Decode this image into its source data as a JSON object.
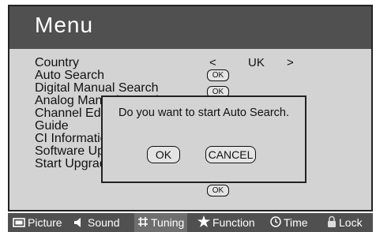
{
  "menu": {
    "title": "Menu",
    "items": [
      {
        "label": "Country"
      },
      {
        "label": "Auto Search"
      },
      {
        "label": "Digital Manual Search"
      },
      {
        "label": "Analog Manual Search"
      },
      {
        "label": "Channel Edit"
      },
      {
        "label": "Guide"
      },
      {
        "label": "CI Information"
      },
      {
        "label": "Software Upgrade"
      },
      {
        "label": "Start Upgrade"
      }
    ],
    "country": {
      "left_arrow": "<",
      "value": "UK",
      "right_arrow": ">"
    },
    "ok_label": "OK"
  },
  "dialog": {
    "message": "Do you want to start Auto Search.",
    "ok_label": "OK",
    "cancel_label": "CANCEL"
  },
  "bottom_bar": {
    "tabs": [
      {
        "label": "Picture",
        "icon": "picture-icon"
      },
      {
        "label": "Sound",
        "icon": "sound-icon"
      },
      {
        "label": "Tuning",
        "icon": "tuning-icon"
      },
      {
        "label": "Function",
        "icon": "star-icon"
      },
      {
        "label": "Time",
        "icon": "clock-icon"
      },
      {
        "label": "Lock",
        "icon": "lock-icon"
      }
    ],
    "active_tab": "Tuning"
  },
  "colors": {
    "header_bg": "#505050",
    "panel_bg": "#d3d3d3",
    "bar_bg": "#505050",
    "text": "#111111"
  }
}
